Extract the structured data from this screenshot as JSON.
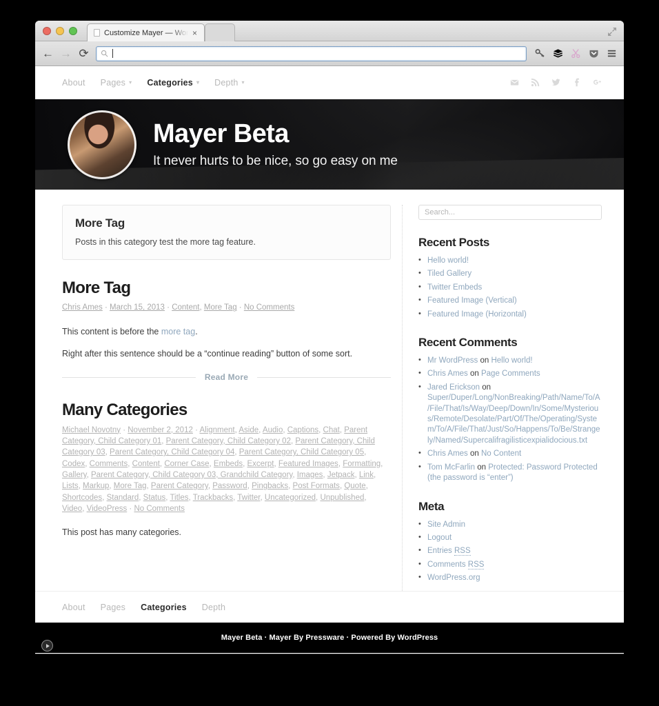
{
  "browser": {
    "tab_title": "Customize Mayer — WordP",
    "tab_close": "×",
    "back_icon": "←",
    "forward_icon": "→",
    "reload_icon": "⟳",
    "url_value": "",
    "toolbar_icons": [
      "key-icon",
      "layers-icon",
      "scissors-icon",
      "pocket-icon",
      "hamburger-menu-icon"
    ],
    "window_controls": [
      "close",
      "minimize",
      "zoom"
    ],
    "fullscreen_icon": "expand-arrows-icon"
  },
  "site": {
    "title": "Mayer Beta",
    "tagline": "It never hurts to be nice, so go easy on me"
  },
  "nav": {
    "items": [
      {
        "label": "About",
        "caret": "",
        "active": false
      },
      {
        "label": "Pages",
        "caret": "▾",
        "active": false
      },
      {
        "label": "Categories",
        "caret": "▾",
        "active": true
      },
      {
        "label": "Depth",
        "caret": "▾",
        "active": false
      }
    ],
    "social": [
      "mail-icon",
      "rss-icon",
      "twitter-icon",
      "facebook-icon",
      "googleplus-icon"
    ]
  },
  "archive": {
    "title": "More Tag",
    "description": "Posts in this category test the more tag feature."
  },
  "posts": [
    {
      "title": "More Tag",
      "author": "Chris Ames",
      "date": "March 15, 2013",
      "categories": [
        "Content",
        "More Tag"
      ],
      "comments": "No Comments",
      "paragraph_1_before": "This content is before the ",
      "paragraph_1_link": "more tag",
      "paragraph_1_after": ".",
      "paragraph_2": "Right after this sentence should be a “continue reading” button of some sort.",
      "read_more": "Read More"
    },
    {
      "title": "Many Categories",
      "author": "Michael Novotny",
      "date": "November 2, 2012",
      "categories": [
        "Alignment",
        "Aside",
        "Audio",
        "Captions",
        "Chat",
        "Parent Category, Child Category 01",
        "Parent Category, Child Category 02",
        "Parent Category, Child Category 03",
        "Parent Category, Child Category 04",
        "Parent Category, Child Category 05",
        "Codex",
        "Comments",
        "Content",
        "Corner Case",
        "Embeds",
        "Excerpt",
        "Featured Images",
        "Formatting",
        "Gallery",
        "Parent Category, Child Category 03, Grandchild Category",
        "Images",
        "Jetpack",
        "Link",
        "Lists",
        "Markup",
        "More Tag",
        "Parent Category",
        "Password",
        "Pingbacks",
        "Post Formats",
        "Quote",
        "Shortcodes",
        "Standard",
        "Status",
        "Titles",
        "Trackbacks",
        "Twitter",
        "Uncategorized",
        "Unpublished",
        "Video",
        "VideoPress"
      ],
      "comments": "No Comments",
      "body": "This post has many categories."
    }
  ],
  "sidebar": {
    "search_placeholder": "Search...",
    "search_value": "",
    "recent_posts": {
      "title": "Recent Posts",
      "items": [
        "Hello world!",
        "Tiled Gallery",
        "Twitter Embeds",
        "Featured Image (Vertical)",
        "Featured Image (Horizontal)"
      ]
    },
    "recent_comments": {
      "title": "Recent Comments",
      "on_label": "on",
      "items": [
        {
          "author": "Mr WordPress",
          "target": "Hello world!"
        },
        {
          "author": "Chris Ames",
          "target": "Page Comments"
        },
        {
          "author": "Jared Erickson",
          "target": "Super/Duper/Long/NonBreaking/Path/Name/To/A/File/That/Is/Way/Deep/Down/In/Some/Mysterious/Remote/Desolate/Part/Of/The/Operating/System/To/A/File/That/Just/So/Happens/To/Be/Strangely/Named/Supercalifragilisticexpialidocious.txt"
        },
        {
          "author": "Chris Ames",
          "target": "No Content"
        },
        {
          "author": "Tom McFarlin",
          "target": "Protected: Password Protected (the password is “enter”)"
        }
      ]
    },
    "meta": {
      "title": "Meta",
      "items": [
        {
          "label": "Site Admin",
          "dotted": ""
        },
        {
          "label": "Logout",
          "dotted": ""
        },
        {
          "label": "Entries ",
          "dotted": "RSS"
        },
        {
          "label": "Comments ",
          "dotted": "RSS"
        },
        {
          "label": "WordPress.org",
          "dotted": ""
        }
      ]
    }
  },
  "footer": {
    "nav": [
      "About",
      "Pages",
      "Categories",
      "Depth"
    ],
    "active": "Categories",
    "credit": "Mayer Beta · Mayer By Pressware · Powered By WordPress"
  },
  "post_meta_separator": " · "
}
